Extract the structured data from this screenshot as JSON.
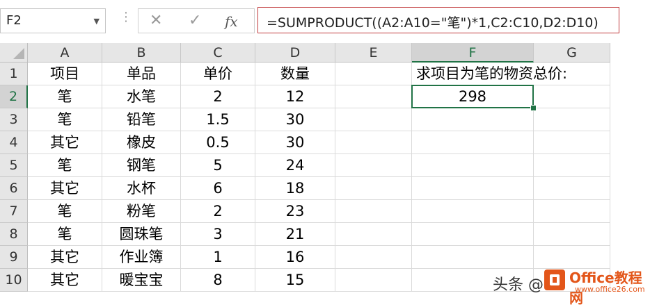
{
  "name_box": {
    "value": "F2"
  },
  "formula_bar": {
    "formula": "=SUMPRODUCT((A2:A10=\"笔\")*1,C2:C10,D2:D10)",
    "fx_label": "fx",
    "cancel_glyph": "✕",
    "enter_glyph": "✓"
  },
  "columns": [
    "A",
    "B",
    "C",
    "D",
    "E",
    "F",
    "G"
  ],
  "rows": [
    "1",
    "2",
    "3",
    "4",
    "5",
    "6",
    "7",
    "8",
    "9",
    "10"
  ],
  "cells": [
    [
      "项目",
      "单品",
      "单价",
      "数量",
      "",
      "求项目为笔的物资总价:",
      ""
    ],
    [
      "笔",
      "水笔",
      "2",
      "12",
      "",
      "298",
      ""
    ],
    [
      "笔",
      "铅笔",
      "1.5",
      "30",
      "",
      "",
      ""
    ],
    [
      "其它",
      "橡皮",
      "0.5",
      "30",
      "",
      "",
      ""
    ],
    [
      "笔",
      "钢笔",
      "5",
      "24",
      "",
      "",
      ""
    ],
    [
      "其它",
      "水杯",
      "6",
      "18",
      "",
      "",
      ""
    ],
    [
      "笔",
      "粉笔",
      "2",
      "23",
      "",
      "",
      ""
    ],
    [
      "笔",
      "圆珠笔",
      "3",
      "21",
      "",
      "",
      ""
    ],
    [
      "其它",
      "作业簿",
      "1",
      "16",
      "",
      "",
      ""
    ],
    [
      "其它",
      "暖宝宝",
      "8",
      "15",
      "",
      "",
      ""
    ]
  ],
  "selected": {
    "column": "F",
    "row": "2"
  },
  "watermark": {
    "prefix": "头条 @",
    "brand": "Office教程网",
    "url": "www.office26.com"
  },
  "colors": {
    "accent": "#217346",
    "formula_border": "#c0393b",
    "brand": "#e3561a"
  }
}
